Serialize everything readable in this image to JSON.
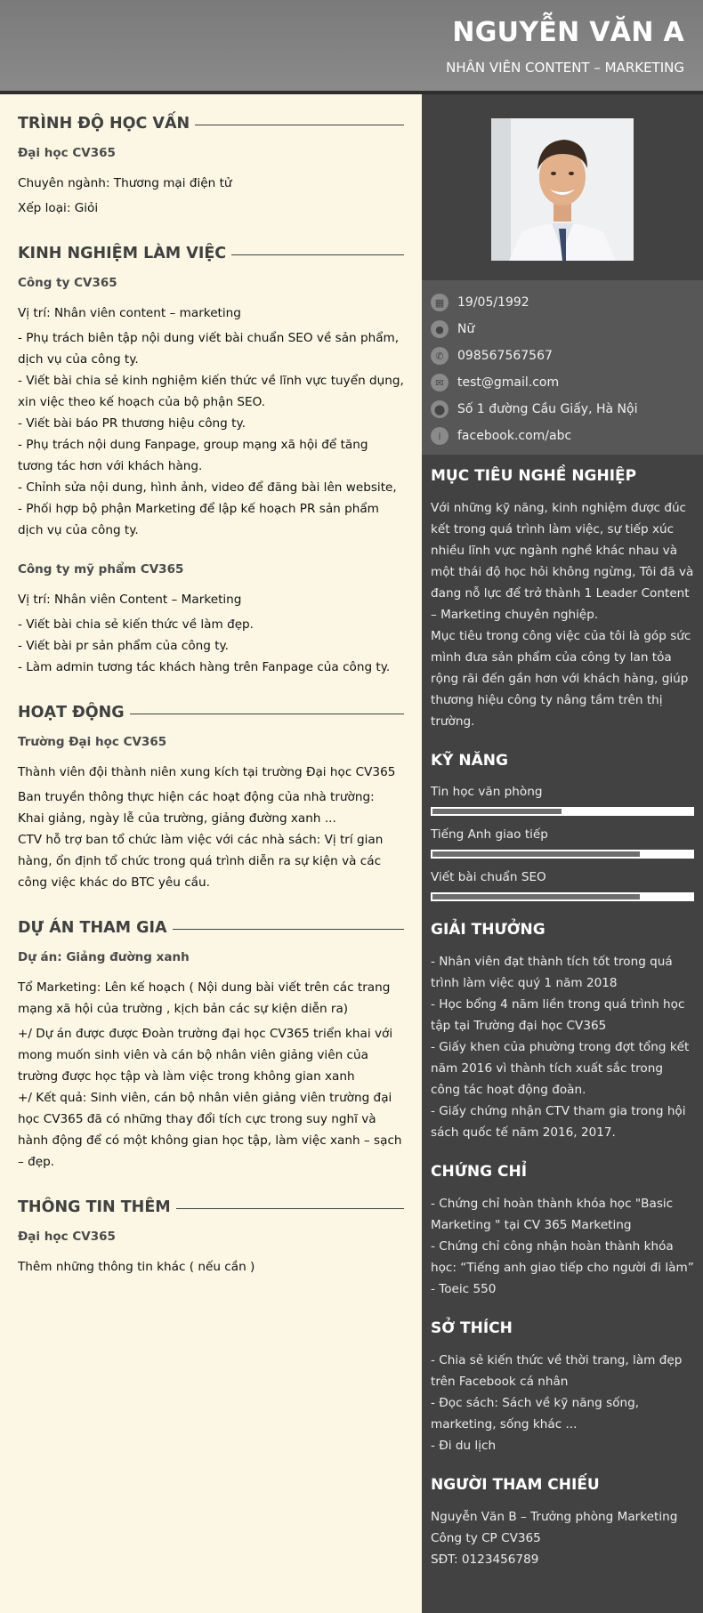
{
  "header": {
    "name": "NGUYỄN VĂN A",
    "job_title": "NHÂN VIÊN CONTENT – MARKETING"
  },
  "education": {
    "title": "TRÌNH ĐỘ HỌC VẤN",
    "school": "Đại học CV365",
    "major": "Chuyên ngành: Thương mại điện tử",
    "grade": "Xếp loại: Giỏi"
  },
  "experience": {
    "title": "KINH NGHIỆM LÀM VIỆC",
    "jobs": [
      {
        "company": "Công ty CV365",
        "position": "Vị trí: Nhân viên content – marketing",
        "duties": [
          "- Phụ trách biên tập nội dung viết bài chuẩn SEO về sản phẩm, dịch vụ của công ty.",
          "- Viết bài chia sẻ kinh nghiệm kiến thức về lĩnh vực tuyển dụng, xin việc theo kế hoạch của bộ phận SEO.",
          "- Viết bài báo PR thương hiệu công ty.",
          "- Phụ trách nội dung Fanpage, group mạng xã hội để tăng tương tác hơn với khách hàng.",
          "- Chỉnh sửa nội dung, hình ảnh, video để đăng bài lên website,",
          "- Phối hợp bộ phận Marketing để lập kế hoạch PR sản phẩm dịch vụ của công ty."
        ]
      },
      {
        "company": "Công ty mỹ phẩm CV365",
        "position": "Vị trí: Nhân viên Content – Marketing",
        "duties": [
          "- Viết bài chia sẻ kiến thức về làm đẹp.",
          "- Viết bài pr sản phẩm của công ty.",
          "- Làm admin tương tác khách hàng trên Fanpage của công ty."
        ]
      }
    ]
  },
  "activities": {
    "title": "HOẠT ĐỘNG",
    "org": "Trường Đại học CV365",
    "role": "Thành viên đội thành niên xung kích tại trường Đại học CV365",
    "details": [
      "Ban truyền thông thực hiện các hoạt động của nhà trường: Khai giảng, ngày lễ của trường, giảng đường xanh ...",
      "CTV hỗ trợ ban tổ chức làm việc với các nhà sách: Vị trí gian hàng, ổn định tổ chức trong quá trình diễn ra sự kiện và các công việc khác do BTC yêu cầu."
    ]
  },
  "projects": {
    "title": "DỰ ÁN THAM GIA",
    "name": "Dự án: Giảng đường xanh",
    "role": "Tổ Marketing: Lên kế hoạch ( Nội dung bài viết trên các trang mạng xã hội của trường , kịch bản các sự kiện diễn ra)",
    "details": [
      "+/ Dự án được được Đoàn trường đại học CV365 triển khai với mong muốn sinh viên và cán bộ nhân viên giảng viên của trường được học tập và làm việc trong không gian xanh",
      "+/ Kết quả: Sinh viên, cán bộ nhân viên giảng viên trường đại học CV365 đã có những thay đổi tích cực trong suy nghĩ và hành động để có một không gian học tập,  làm việc xanh – sạch – đẹp."
    ]
  },
  "extra": {
    "title": "THÔNG TIN THÊM",
    "org": "Đại học CV365",
    "text": "Thêm những thông tin khác ( nếu cần )"
  },
  "contact": [
    {
      "icon": "calendar-icon",
      "glyph": "▦",
      "value": "19/05/1992"
    },
    {
      "icon": "user-icon",
      "glyph": "●",
      "value": "Nữ"
    },
    {
      "icon": "phone-icon",
      "glyph": "✆",
      "value": "098567567567"
    },
    {
      "icon": "email-icon",
      "glyph": "✉",
      "value": "test@gmail.com"
    },
    {
      "icon": "location-icon",
      "glyph": "⬤",
      "value": "Số 1 đường Cầu Giấy, Hà Nội"
    },
    {
      "icon": "info-icon",
      "glyph": "i",
      "value": "facebook.com/abc"
    }
  ],
  "objective": {
    "title": "MỤC TIÊU NGHỀ NGHIỆP",
    "paragraphs": [
      "Với những kỹ năng, kinh nghiệm được đúc kết trong quá trình làm việc, sự tiếp xúc nhiều lĩnh vực ngành nghề khác nhau và một thái độ học hỏi không ngừng, Tôi đã và đang nỗ lực để trở thành 1 Leader Content – Marketing chuyên nghiệp.",
      "Mục tiêu trong công việc của tôi là góp sức mình đưa sản phẩm của công ty lan tỏa rộng rãi đến gần hơn với khách hàng, giúp thương hiệu công ty nâng tầm trên thị trường."
    ]
  },
  "skills": {
    "title": "KỸ NĂNG",
    "items": [
      {
        "name": "Tin học văn phòng",
        "level": 0.5
      },
      {
        "name": "Tiếng Anh giao tiếp",
        "level": 0.8
      },
      {
        "name": "Viết bài chuẩn SEO",
        "level": 0.8
      }
    ]
  },
  "awards": {
    "title": "GIẢI THƯỞNG",
    "items": [
      "- Nhân viên đạt thành tích tốt trong quá trình làm việc quý 1 năm 2018",
      "- Học bổng 4 năm liền trong quá trình học tập tại Trường đại học CV365",
      "- Giấy khen của phường trong đợt tổng kết năm 2016 vì thành tích xuất sắc trong công tác hoạt động đoàn.",
      "- Giấy chứng nhận CTV tham gia trong hội sách quốc tế năm 2016, 2017."
    ]
  },
  "certificates": {
    "title": "CHỨNG CHỈ",
    "items": [
      "- Chứng chỉ hoàn thành khóa học \"Basic Marketing \" tại CV 365 Marketing",
      "- Chứng chỉ công nhận hoàn thành khóa học: “Tiếng anh giao tiếp cho người đi làm”",
      "- Toeic 550"
    ]
  },
  "hobbies": {
    "title": "SỞ THÍCH",
    "items": [
      "- Chia sẻ kiến thức về thời trang, làm đẹp trên Facebook cá nhân",
      "- Đọc sách: Sách về kỹ năng sống, marketing, sống khác ...",
      "- Đi du lịch"
    ]
  },
  "references": {
    "title": "NGƯỜI THAM CHIẾU",
    "lines": [
      "Nguyễn Văn B – Trưởng phòng Marketing",
      "Công ty CP CV365",
      "SĐT: 0123456789"
    ]
  }
}
